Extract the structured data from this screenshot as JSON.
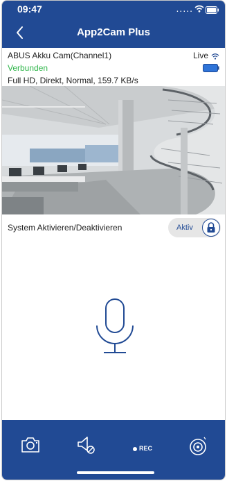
{
  "status_bar": {
    "time": "09:47",
    "signal_dots": "....."
  },
  "nav": {
    "title": "App2Cam Plus"
  },
  "camera": {
    "name": "ABUS Akku Cam(Channel1)",
    "connection_status": "Verbunden",
    "stream_info": "Full HD, Direkt, Normal, 159.7 KB/s",
    "live_label": "Live"
  },
  "system": {
    "label": "System Aktivieren/Deaktivieren",
    "toggle_label": "Aktiv"
  },
  "bottom_bar": {
    "rec_label": "REC"
  },
  "colors": {
    "brand_blue": "#214a94",
    "connected_green": "#2fb64a"
  },
  "icons": [
    "back-icon",
    "wifi-icon",
    "battery-icon",
    "lock-icon",
    "microphone-icon",
    "camera-snapshot-icon",
    "speaker-mute-icon",
    "record-dot-icon",
    "alarm-siren-icon"
  ]
}
